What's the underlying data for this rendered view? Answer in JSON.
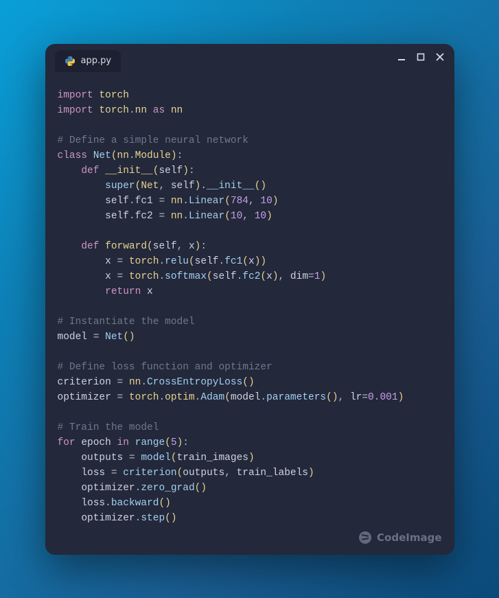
{
  "tab": {
    "filename": "app.py"
  },
  "watermark": "CodeImage",
  "code": {
    "l01_import": "import",
    "l01_torch": "torch",
    "l02_import": "import",
    "l02_mod": "torch",
    "l02_dot": ".",
    "l02_nn": "nn",
    "l02_as": "as",
    "l02_alias": "nn",
    "l04_cmt": "# Define a simple neural network",
    "l05_class": "class",
    "l05_name": "Net",
    "l05_nn": "nn",
    "l05_mod": "Module",
    "l06_def": "def",
    "l06_init": "__init__",
    "l06_self": "self",
    "l07_super": "super",
    "l07_Net": "Net",
    "l07_self": "self",
    "l07_init": "__init__",
    "l08_self": "self",
    "l08_fc1": "fc1",
    "l08_nn": "nn",
    "l08_Linear": "Linear",
    "l08_a": "784",
    "l08_b": "10",
    "l09_self": "self",
    "l09_fc2": "fc2",
    "l09_nn": "nn",
    "l09_Linear": "Linear",
    "l09_a": "10",
    "l09_b": "10",
    "l11_def": "def",
    "l11_fwd": "forward",
    "l11_self": "self",
    "l11_x": "x",
    "l12_x": "x",
    "l12_torch": "torch",
    "l12_relu": "relu",
    "l12_self": "self",
    "l12_fc1": "fc1",
    "l12_x2": "x",
    "l13_x": "x",
    "l13_torch": "torch",
    "l13_softmax": "softmax",
    "l13_self": "self",
    "l13_fc2": "fc2",
    "l13_x2": "x",
    "l13_dim": "dim",
    "l13_one": "1",
    "l14_ret": "return",
    "l14_x": "x",
    "l16_cmt": "# Instantiate the model",
    "l17_model": "model",
    "l17_Net": "Net",
    "l19_cmt": "# Define loss function and optimizer",
    "l20_crit": "criterion",
    "l20_nn": "nn",
    "l20_cel": "CrossEntropyLoss",
    "l21_opt": "optimizer",
    "l21_torch": "torch",
    "l21_optim": "optim",
    "l21_Adam": "Adam",
    "l21_model": "model",
    "l21_params": "parameters",
    "l21_lr": "lr",
    "l21_lrval": "0.001",
    "l23_cmt": "# Train the model",
    "l24_for": "for",
    "l24_epoch": "epoch",
    "l24_in": "in",
    "l24_range": "range",
    "l24_five": "5",
    "l25_outputs": "outputs",
    "l25_model": "model",
    "l25_ti": "train_images",
    "l26_loss": "loss",
    "l26_crit": "criterion",
    "l26_out": "outputs",
    "l26_tl": "train_labels",
    "l27_opt": "optimizer",
    "l27_zg": "zero_grad",
    "l28_loss": "loss",
    "l28_bw": "backward",
    "l29_opt": "optimizer",
    "l29_step": "step"
  }
}
